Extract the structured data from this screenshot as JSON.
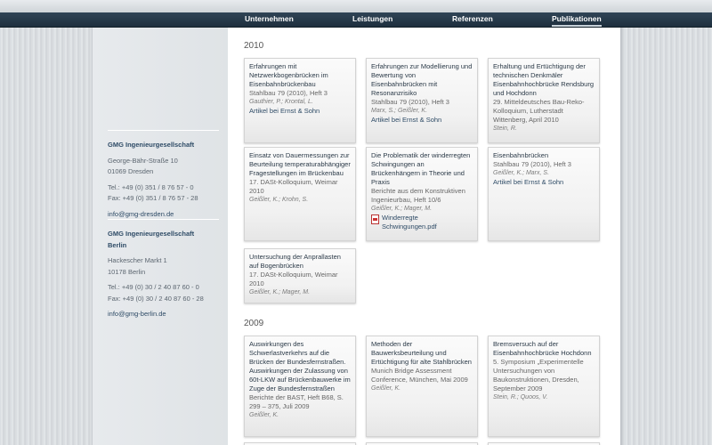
{
  "nav": {
    "items": [
      {
        "label": "Unternehmen"
      },
      {
        "label": "Leistungen"
      },
      {
        "label": "Referenzen"
      },
      {
        "label": "Publikationen",
        "active": true
      }
    ]
  },
  "offices": [
    {
      "name": "GMG Ingenieurgesellschaft",
      "street": "George-Bähr-Straße 10",
      "city": "01069 Dresden",
      "tel": "Tel.: +49 (0) 351 / 8 76 57 - 0",
      "fax": "Fax: +49 (0) 351 / 8 76 57 - 28",
      "email": "info@gmg-dresden.de"
    },
    {
      "name": "GMG Ingenieurgesellschaft Berlin",
      "street": "Hackescher Markt 1",
      "city": "10178 Berlin",
      "tel": "Tel.: +49 (0) 30 / 2 40 87 60 - 0",
      "fax": "Fax: +49 (0) 30 / 2 40 87 60 - 28",
      "email": "info@gmg-berlin.de"
    }
  ],
  "years": [
    {
      "year": "2010",
      "pubs": [
        {
          "title": "Erfahrungen mit Netzwerkbogenbrücken im Eisenbahnbrückenbau",
          "source": "Stahlbau 79 (2010), Heft 3",
          "authors": "Gauthier, P.; Krontal, L.",
          "link": "Artikel bei Ernst & Sohn"
        },
        {
          "title": "Erfahrungen zur Modellierung und Bewertung von Eisenbahnbrücken mit Resonanzrisiko",
          "source": "Stahlbau 79 (2010), Heft 3",
          "authors": "Marx, S.; Geißler, K.",
          "link": "Artikel bei Ernst & Sohn"
        },
        {
          "title": "Erhaltung und Ertüchtigung der technischen Denkmäler Eisenbahnhochbrücke Rendsburg und Hochdonn",
          "source": "29. Mitteldeutsches Bau-Reko-Kolloquium, Lutherstadt Wittenberg, April 2010",
          "authors": "Stein, R."
        },
        {
          "title": "Einsatz von Dauermessungen zur Beurteilung temperaturabhängiger Fragestellungen im Brückenbau",
          "source": "17. DASt-Kolloquium, Weimar 2010",
          "authors": "Geißler, K.; Krohn, S."
        },
        {
          "title": "Die Problematik der winderregten Schwingungen an Brückenhängern in Theorie und Praxis",
          "source": "Berichte aus dem Konstruktiven Ingenieurbau, Heft 10/6",
          "authors": "Geißler, K.; Mager, M.",
          "pdf": "Winderregte Schwingungen.pdf"
        },
        {
          "title": "Eisenbahnbrücken",
          "source": "Stahlbau 79 (2010), Heft 3",
          "authors": "Geißler, K.; Marx, S.",
          "link": "Artikel bei Ernst & Sohn"
        },
        {
          "title": "Untersuchung der Anprallasten auf Bogenbrücken",
          "source": "17. DASt-Kolloquium, Weimar 2010",
          "authors": "Geißler, K.; Mager, M."
        }
      ]
    },
    {
      "year": "2009",
      "pubs": [
        {
          "title": "Auswirkungen des Schwerlastverkehrs auf die Brücken der Bundesfernstraßen. Auswirkungen der Zulassung von 60t-LKW auf Brückenbauwerke im Zuge der Bundesfernstraßen",
          "source": "Berichte der BAST, Heft B68, S. 299 – 375, Juli 2009",
          "authors": "Geißler, K."
        },
        {
          "title": "Methoden der Bauwerksbeurteilung und Ertüchtigung für alte Stahlbrücken",
          "source": "Munich Bridge Assessment Conference, München, Mai 2009",
          "authors": "Geißler, K."
        },
        {
          "title": "Bremsversuch auf der Eisenbahnhochbrücke Hochdonn",
          "source": "5. Symposium „Experimentelle Untersuchungen von Baukonstruktionen, Dresden, September 2009",
          "authors": "Stein, R.; Quoos, V."
        }
      ]
    }
  ]
}
